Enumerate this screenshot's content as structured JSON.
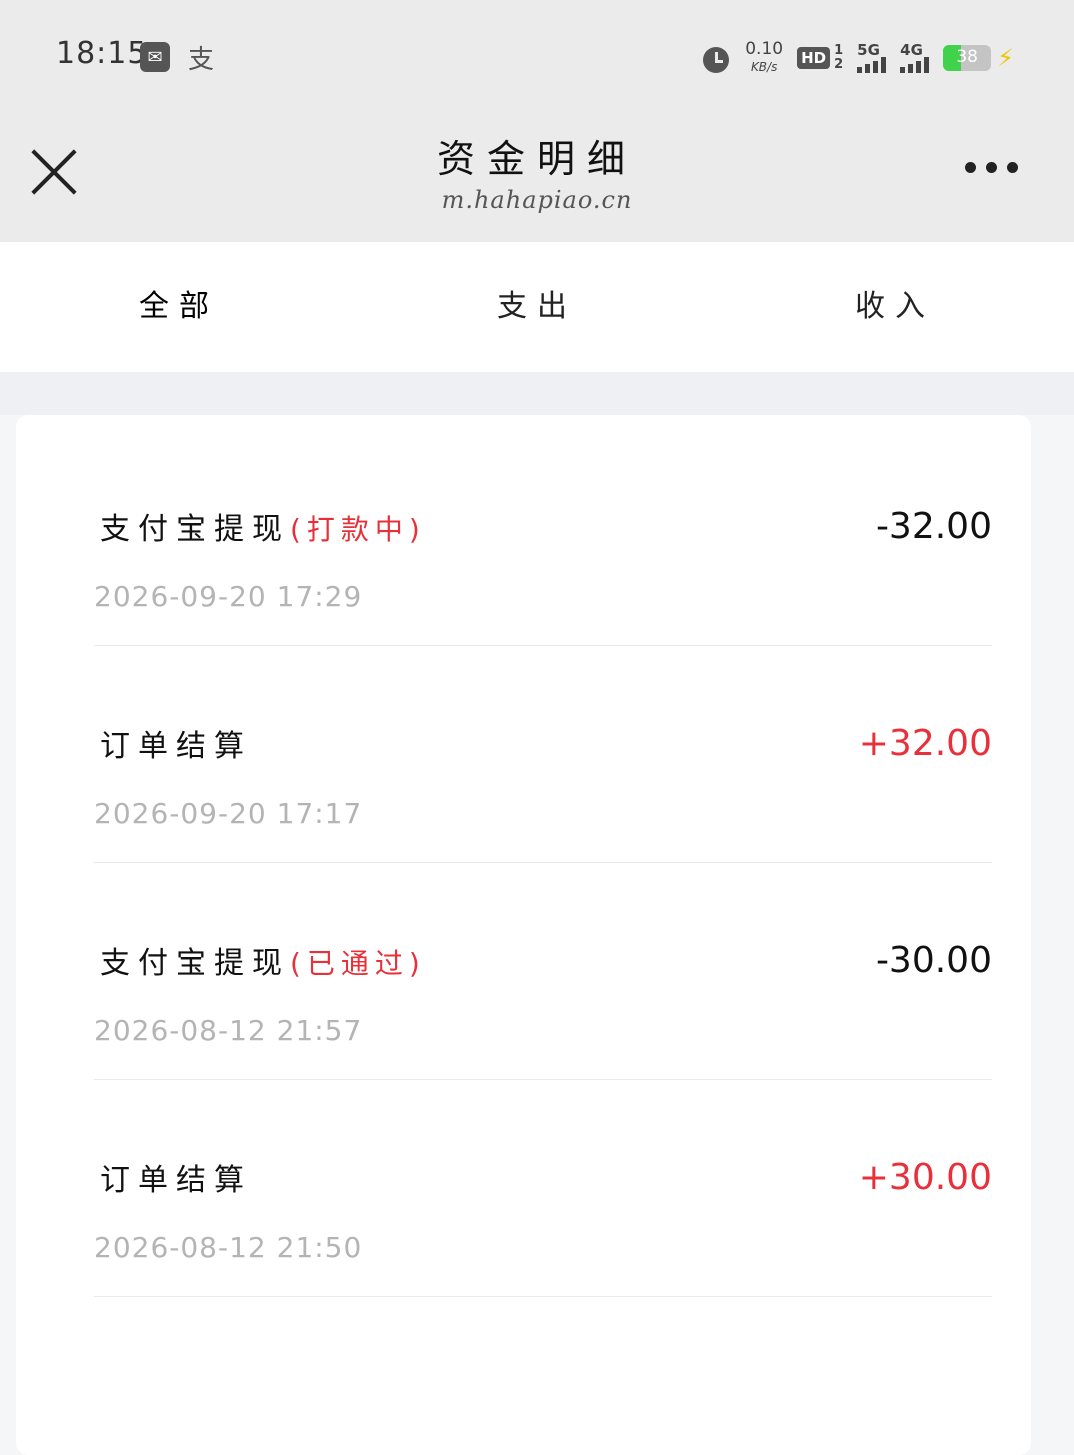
{
  "status_bar": {
    "time": "18:15",
    "app_icons": [
      "wechat-icon",
      "alipay-icon"
    ],
    "alipay_glyph": "支",
    "net_speed_value": "0.10",
    "net_speed_unit": "KB/s",
    "hd_label": "HD",
    "sim_1": "1",
    "sim_2": "2",
    "network_1": "5G",
    "network_2": "4G",
    "battery_level": "38",
    "battery_percent": 38,
    "battery_color": "#3fd24a"
  },
  "nav": {
    "title": "资金明细",
    "subtitle": "m.hahapiao.cn"
  },
  "tabs": [
    {
      "label": "全部",
      "active": true
    },
    {
      "label": "支出",
      "active": false
    },
    {
      "label": "收入",
      "active": false
    }
  ],
  "records": [
    {
      "title": "支付宝提现",
      "status": "(打款中)",
      "time": "2026-09-20 17:29",
      "amount": "-32.00",
      "type": "expense"
    },
    {
      "title": "订单结算",
      "status": "",
      "time": "2026-09-20 17:17",
      "amount": "+32.00",
      "type": "income"
    },
    {
      "title": "支付宝提现",
      "status": "(已通过)",
      "time": "2026-08-12 21:57",
      "amount": "-30.00",
      "type": "expense"
    },
    {
      "title": "订单结算",
      "status": "",
      "time": "2026-08-12 21:50",
      "amount": "+30.00",
      "type": "income"
    }
  ],
  "colors": {
    "accent_red": "#e8303a",
    "header_bg": "#ebebeb",
    "time_gray": "#b4b4b4"
  }
}
